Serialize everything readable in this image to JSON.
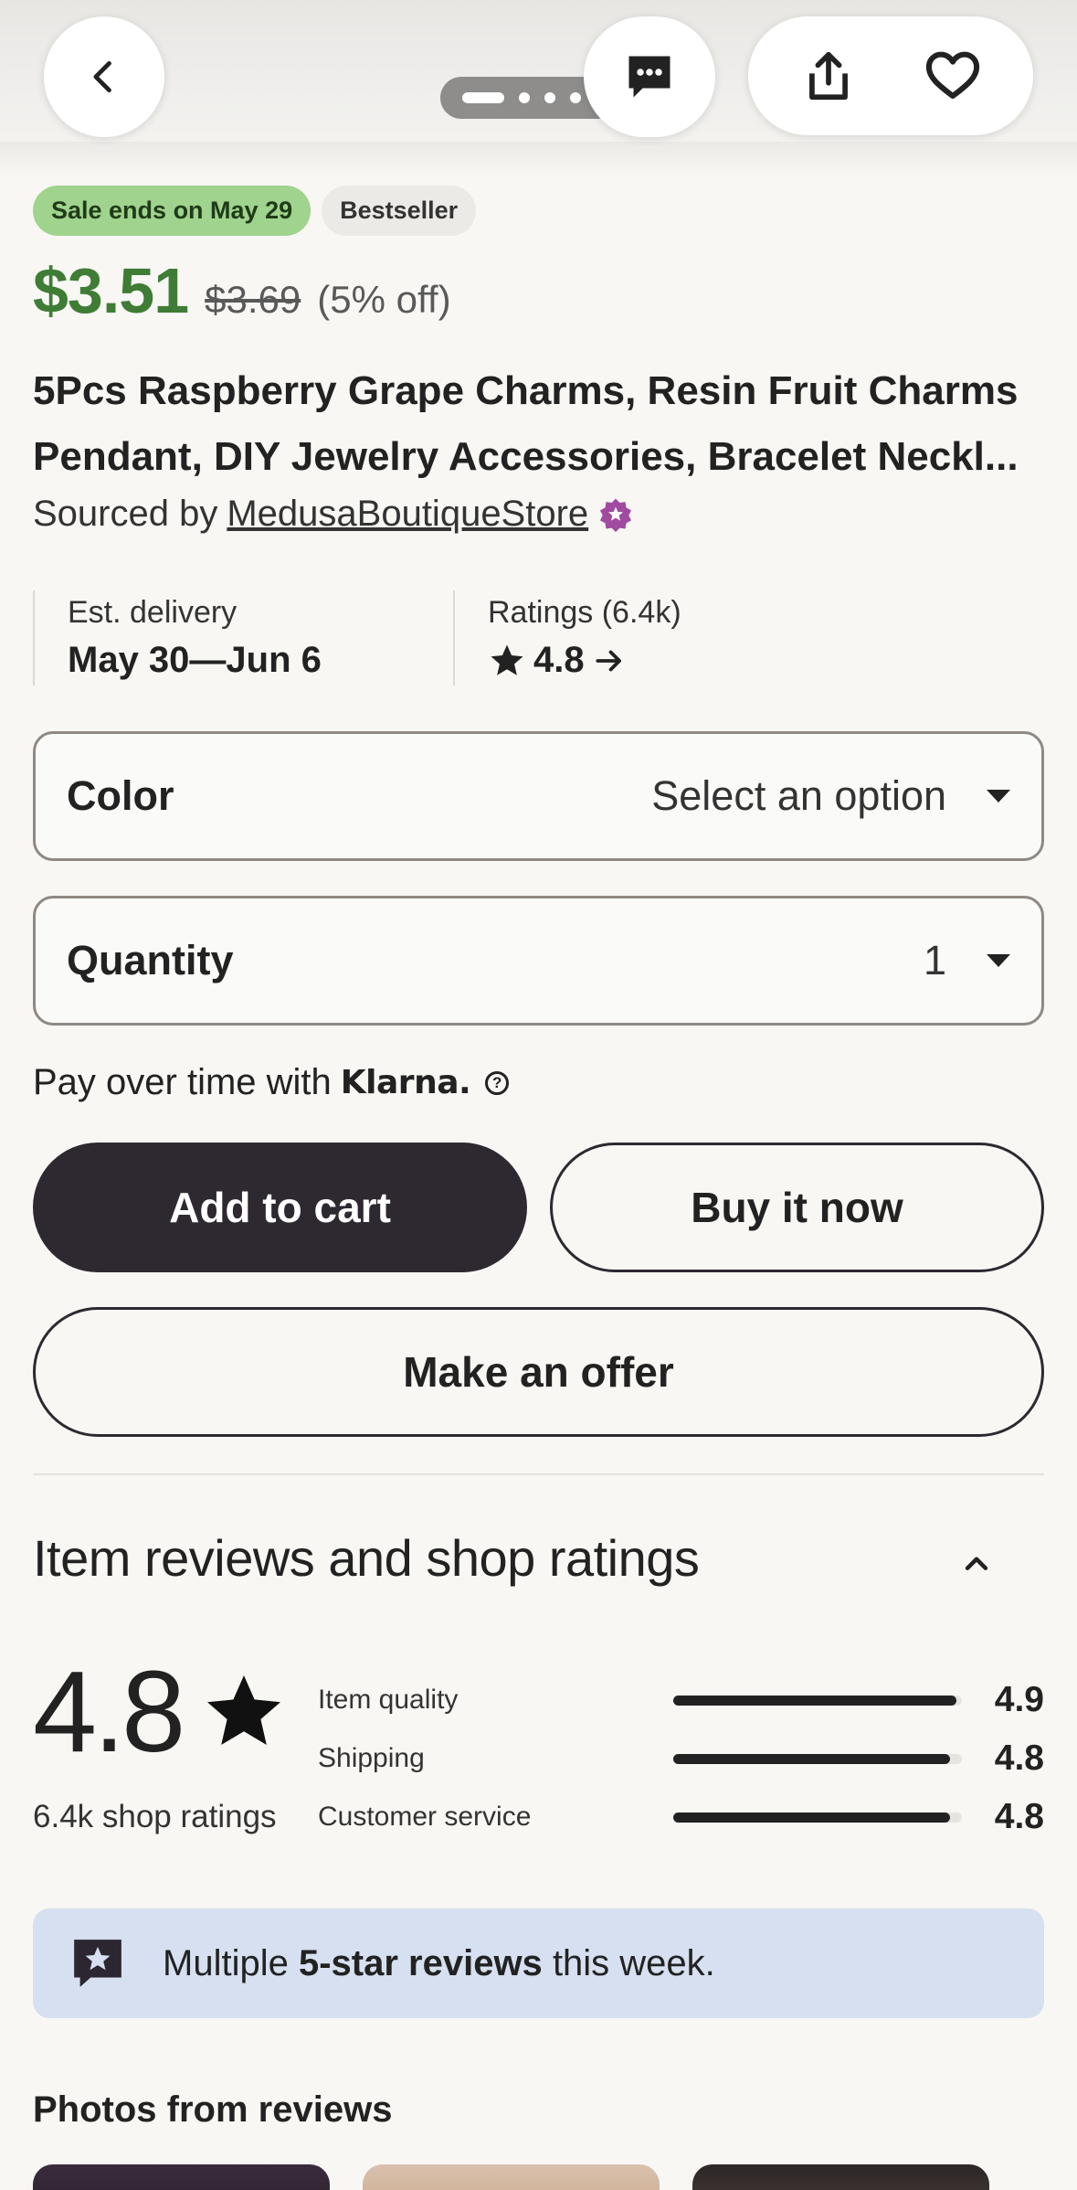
{
  "header": {
    "back_icon": "chevron-left-icon",
    "message_icon": "message-dots-icon",
    "share_icon": "share-icon",
    "favorite_icon": "heart-outline-icon",
    "carousel_total_dots": 4,
    "carousel_active_index": 0
  },
  "badges": {
    "sale": "Sale ends on May 29",
    "bestseller": "Bestseller"
  },
  "price": {
    "current": "$3.51",
    "original": "$3.69",
    "discount": "(5% off)"
  },
  "product": {
    "title": "5Pcs Raspberry Grape Charms, Resin Fruit Charms Pendant, DIY Jewelry Accessories, Bracelet Neckl...",
    "sourced_prefix": "Sourced by",
    "shop_name": "MedusaBoutiqueStore",
    "star_seller_icon": "star-seller-badge-icon"
  },
  "info": {
    "delivery_label": "Est. delivery",
    "delivery_value": "May 30—Jun 6",
    "ratings_label": "Ratings (6.4k)",
    "ratings_value": "4.8"
  },
  "options": {
    "color_label": "Color",
    "color_value": "Select an option",
    "quantity_label": "Quantity",
    "quantity_value": "1"
  },
  "klarna": {
    "text": "Pay over time with",
    "logo": "Klarna."
  },
  "actions": {
    "add_to_cart": "Add to cart",
    "buy_now": "Buy it now",
    "make_offer": "Make an offer"
  },
  "reviews": {
    "section_title": "Item reviews and shop ratings",
    "overall": "4.8",
    "shop_ratings": "6.4k shop ratings",
    "metrics": [
      {
        "label": "Item quality",
        "value": "4.9",
        "fraction": 0.98
      },
      {
        "label": "Shipping",
        "value": "4.8",
        "fraction": 0.96
      },
      {
        "label": "Customer service",
        "value": "4.8",
        "fraction": 0.96
      }
    ],
    "notice_prefix": "Multiple",
    "notice_bold": "5-star reviews",
    "notice_suffix": "this week.",
    "photos_title": "Photos from reviews"
  },
  "colors": {
    "price_green": "#3f7c35",
    "sale_badge": "#a0d38e",
    "primary_button": "#2e2830",
    "notice_bg": "#d6e0f0",
    "star_seller": "#a04aa0"
  }
}
